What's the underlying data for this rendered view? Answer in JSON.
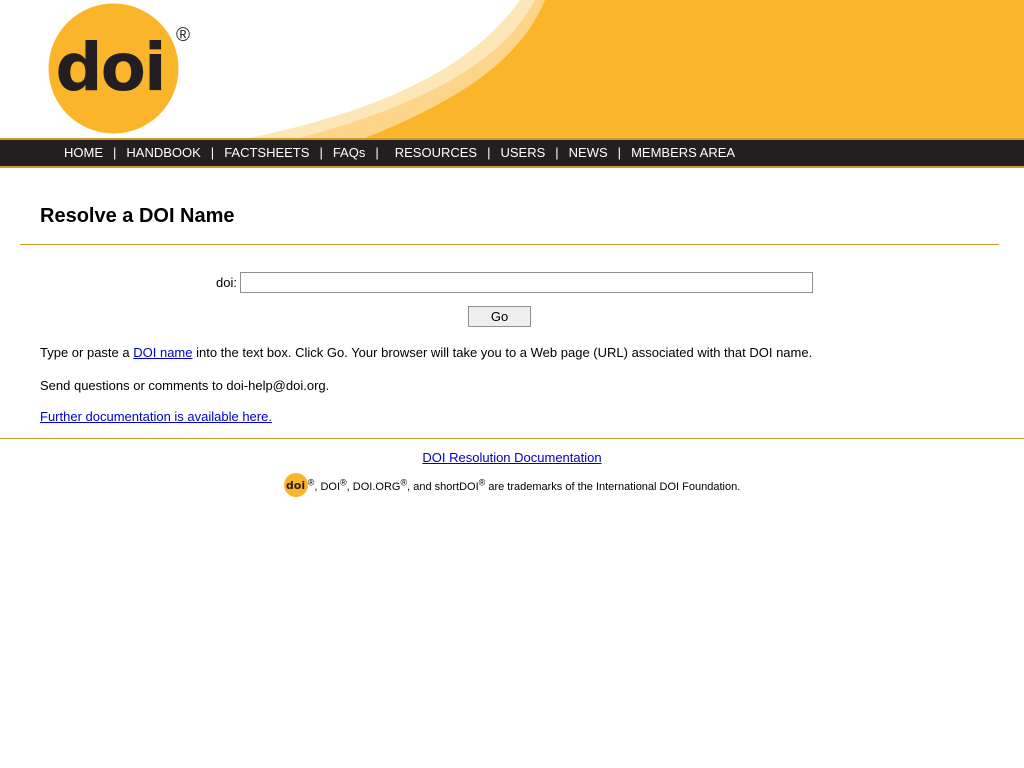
{
  "header": {
    "logo_text": "doi",
    "registered_mark": "®"
  },
  "nav": {
    "items": [
      {
        "label": "HOME"
      },
      {
        "label": "HANDBOOK"
      },
      {
        "label": "FACTSHEETS"
      },
      {
        "label": "FAQs"
      },
      {
        "label": "RESOURCES"
      },
      {
        "label": "USERS"
      },
      {
        "label": "NEWS"
      },
      {
        "label": "MEMBERS AREA"
      }
    ],
    "separator": "|"
  },
  "main": {
    "title": "Resolve a DOI Name",
    "form": {
      "label": "doi:",
      "input_value": "",
      "go_label": "Go"
    },
    "instructions": {
      "prefix": "Type or paste a ",
      "link": "DOI name",
      "suffix": " into the text box. Click Go. Your browser will take you to a Web page (URL) associated with that DOI name."
    },
    "contact": "Send questions or comments to doi-help@doi.org.",
    "docs_link": "Further documentation is available here."
  },
  "footer": {
    "doc_link": "DOI Resolution Documentation",
    "trademark": {
      "reg": "®",
      "t1": ", DOI",
      "t2": ", DOI.ORG",
      "t3": ", and shortDOI",
      "t4": " are trademarks of the International DOI Foundation."
    }
  },
  "colors": {
    "brand_orange": "#fbb52b",
    "nav_bg": "#231f20",
    "rule": "#c79a2c",
    "link": "#0000cc"
  }
}
